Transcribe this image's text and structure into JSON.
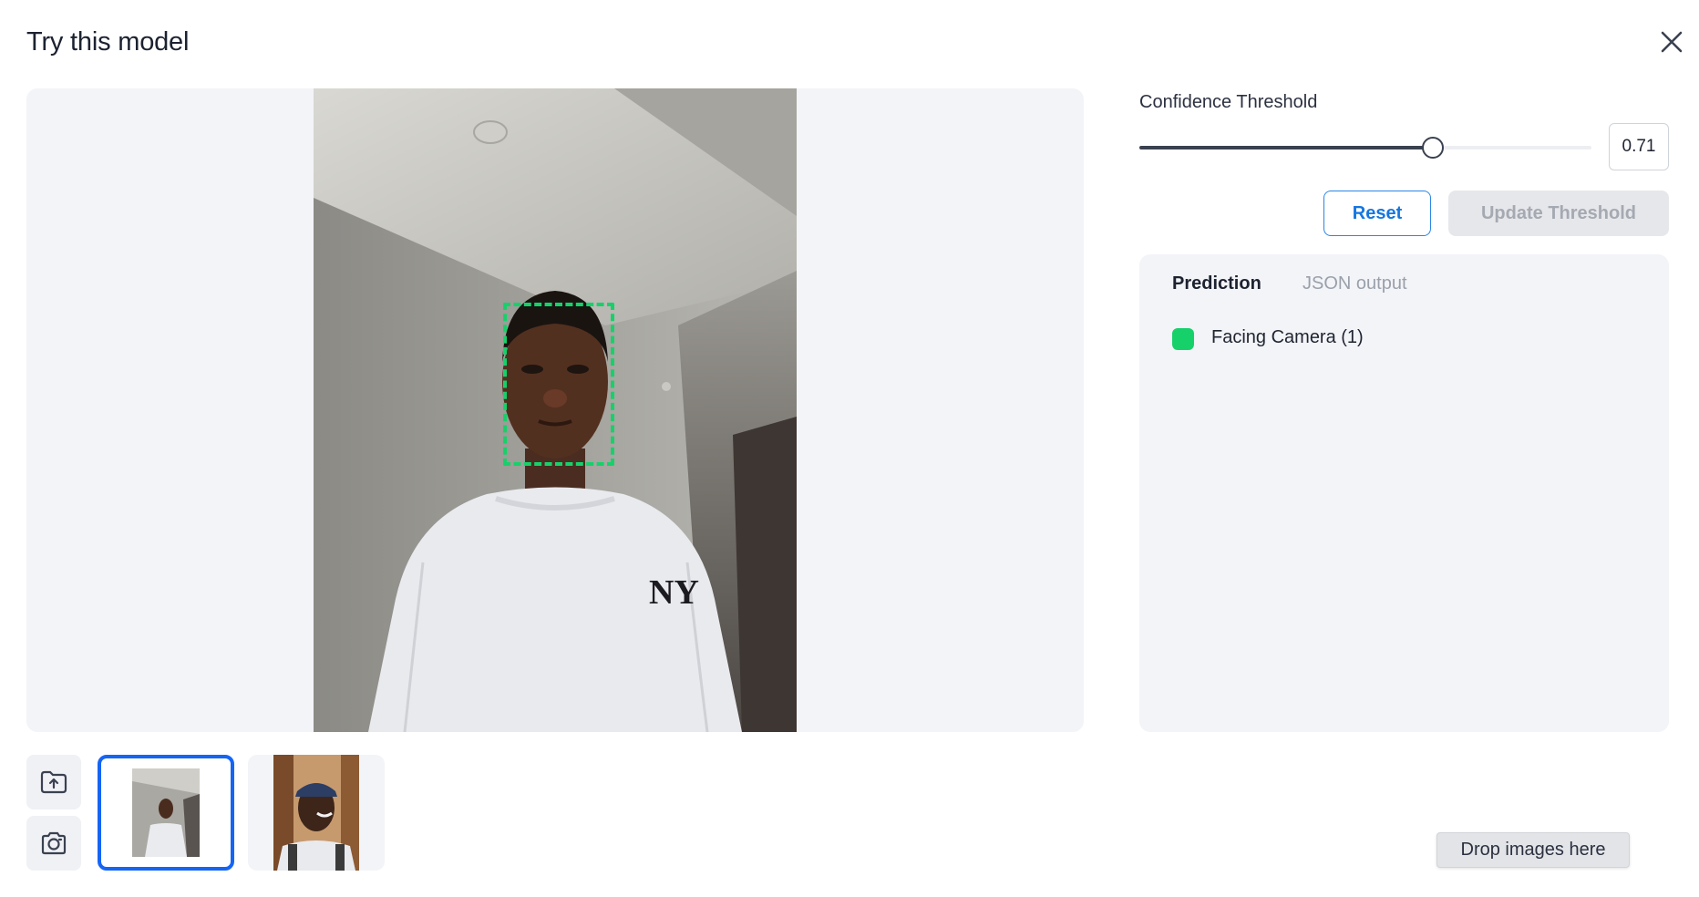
{
  "modal": {
    "title": "Try this model",
    "close_icon": "close-icon"
  },
  "threshold": {
    "label": "Confidence Threshold",
    "value": "0.71",
    "slider_fraction": 0.65,
    "reset_label": "Reset",
    "update_label": "Update Threshold"
  },
  "results": {
    "tabs": [
      "Prediction",
      "JSON output"
    ],
    "active_tab": "Prediction",
    "predictions": [
      {
        "label": "Facing Camera (1)",
        "color": "#16d16a"
      }
    ]
  },
  "detection": {
    "box_color": "#16d16a"
  },
  "toolbar": {
    "upload_icon": "folder-upload-icon",
    "camera_icon": "camera-icon"
  },
  "thumbnails": {
    "count": 2,
    "selected_index": 0,
    "selected_border": "#1565f5"
  },
  "drop_hint": "Drop images here",
  "colors": {
    "accent": "#1576e0",
    "panel_bg": "#f3f4f8"
  }
}
